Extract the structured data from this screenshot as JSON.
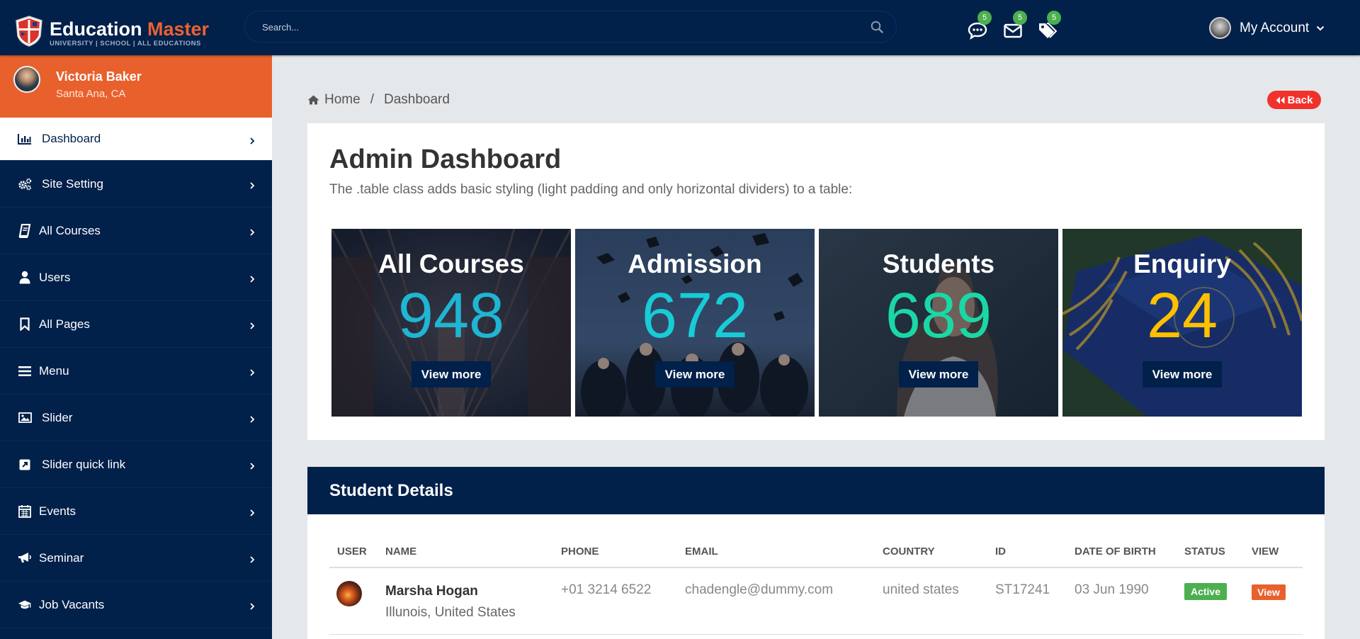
{
  "brand": {
    "title_white": "Education",
    "title_orange": "Master",
    "subtitle": "UNIVERSITY | SCHOOL | ALL EDUCATIONS"
  },
  "search": {
    "placeholder": "Search..."
  },
  "notifications": [
    {
      "icon": "chat-icon",
      "count": "5"
    },
    {
      "icon": "envelope-icon",
      "count": "5"
    },
    {
      "icon": "tags-icon",
      "count": "5"
    }
  ],
  "account": {
    "label": "My Account"
  },
  "profile": {
    "name": "Victoria Baker",
    "location": "Santa Ana, CA"
  },
  "sidebar": {
    "items": [
      {
        "label": "Dashboard",
        "icon": "bar-chart-icon",
        "active": true
      },
      {
        "label": "Site Setting",
        "icon": "cogs-icon"
      },
      {
        "label": "All Courses",
        "icon": "book-icon"
      },
      {
        "label": "Users",
        "icon": "user-icon"
      },
      {
        "label": "All Pages",
        "icon": "bookmark-icon"
      },
      {
        "label": "Menu",
        "icon": "bars-icon"
      },
      {
        "label": "Slider",
        "icon": "image-icon"
      },
      {
        "label": "Slider quick link",
        "icon": "external-link-icon"
      },
      {
        "label": "Events",
        "icon": "calendar-icon"
      },
      {
        "label": "Seminar",
        "icon": "bullhorn-icon"
      },
      {
        "label": "Job Vacants",
        "icon": "graduation-cap-icon"
      }
    ]
  },
  "breadcrumb": {
    "home": "Home",
    "separator": "/",
    "current": "Dashboard"
  },
  "back_button": "Back",
  "dashboard": {
    "title": "Admin Dashboard",
    "description": "The .table class adds basic styling (light padding and only horizontal dividers) to a table:",
    "stats": [
      {
        "title": "All Courses",
        "value": "948",
        "color": "#1fb5d4",
        "button": "View more"
      },
      {
        "title": "Admission",
        "value": "672",
        "color": "#18ccd6",
        "button": "View more"
      },
      {
        "title": "Students",
        "value": "689",
        "color": "#1ad8a6",
        "button": "View more"
      },
      {
        "title": "Enquiry",
        "value": "24",
        "color": "#ffc000",
        "button": "View more"
      }
    ]
  },
  "students": {
    "title": "Student Details",
    "columns": [
      "USER",
      "NAME",
      "PHONE",
      "EMAIL",
      "COUNTRY",
      "ID",
      "DATE OF BIRTH",
      "STATUS",
      "VIEW"
    ],
    "rows": [
      {
        "name": "Marsha Hogan",
        "address": "Illunois, United States",
        "phone": "+01 3214 6522",
        "email": "chadengle@dummy.com",
        "country": "united states",
        "id": "ST17241",
        "dob": "03 Jun 1990",
        "status": "Active",
        "view": "View"
      }
    ]
  },
  "colors": {
    "navy": "#01204a",
    "orange": "#e8612d",
    "red": "#f0322b",
    "green": "#4caf50",
    "view_orange": "#e8612d"
  }
}
